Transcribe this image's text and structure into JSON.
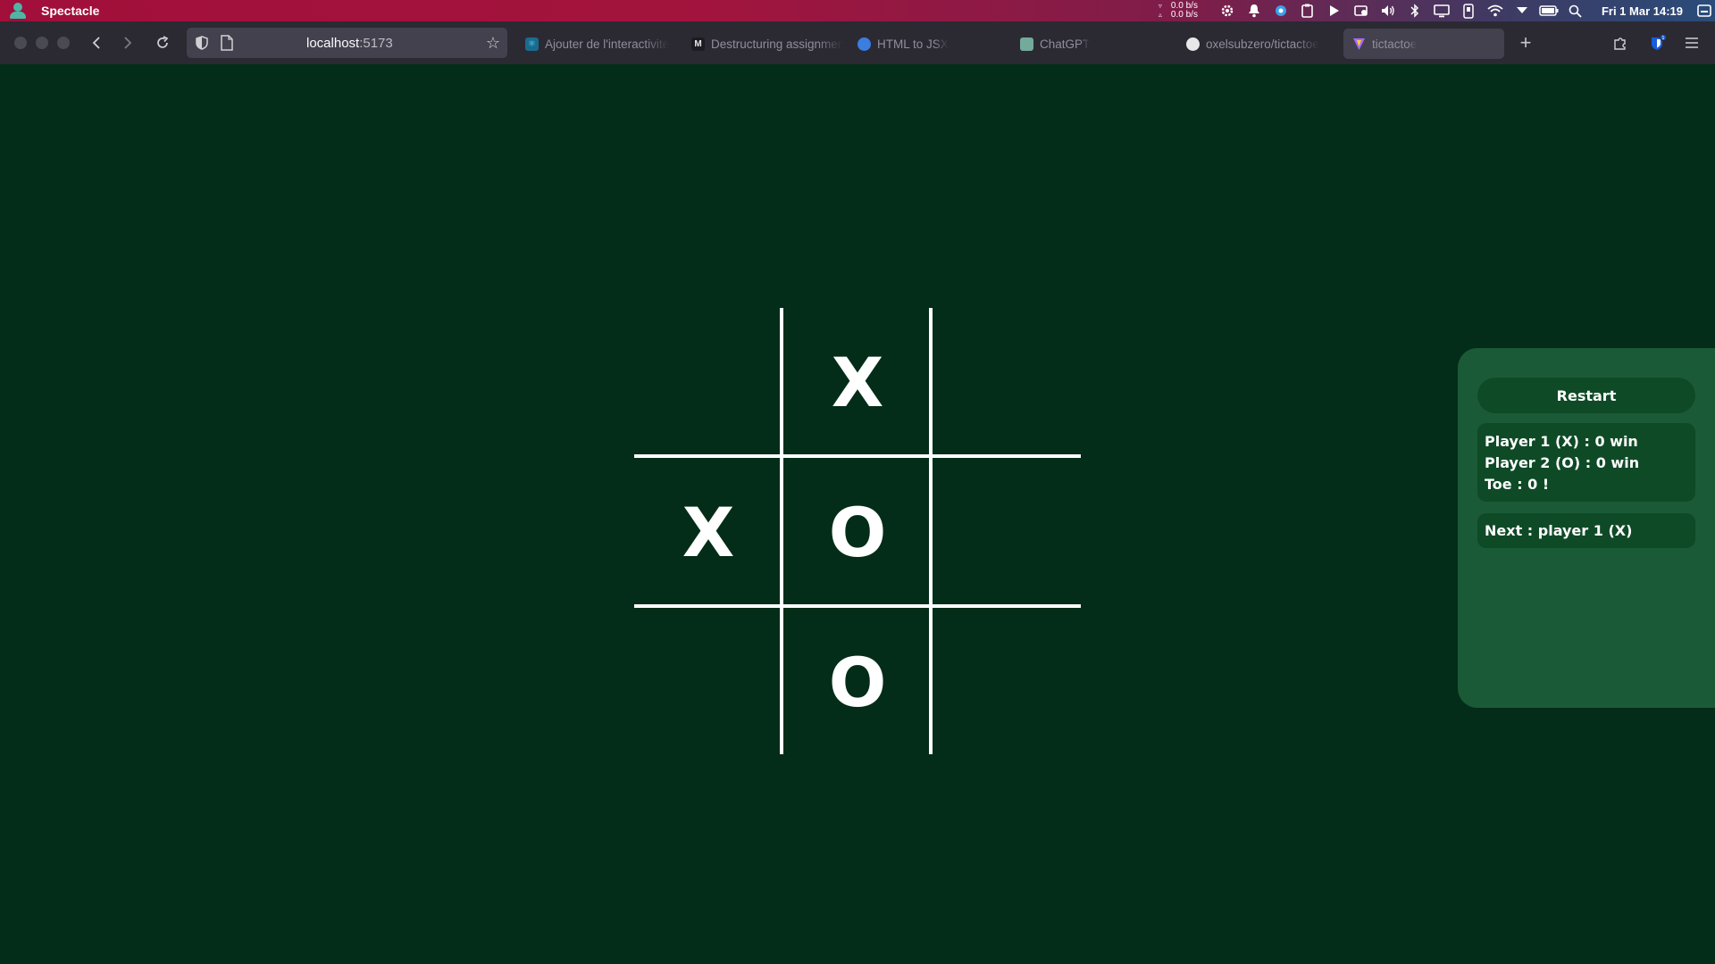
{
  "system_bar": {
    "app_name": "Spectacle",
    "net_up": "0.0 b/s",
    "net_down": "0.0 b/s",
    "clock": "Fri 1 Mar 14:19",
    "tray_icons": [
      "settings-gear-icon",
      "bell-icon",
      "gear-blue-icon",
      "clipboard-icon",
      "play-icon",
      "device-icon",
      "volume-icon",
      "bluetooth-icon",
      "display-icon",
      "usb-icon",
      "wifi-icon",
      "arrow-down-icon",
      "battery-icon",
      "search-icon",
      "window-icon"
    ]
  },
  "browser": {
    "url_host": "localhost",
    "url_port": ":5173",
    "tabs": [
      {
        "label": "Ajouter de l'interactivité",
        "icon": "react-icon",
        "color": "#1b6b8f"
      },
      {
        "label": "Destructuring assignment",
        "icon": "mdn-icon",
        "color": "#1c1b22"
      },
      {
        "label": "HTML to JSX",
        "icon": "globe-icon",
        "color": "#3c7de0"
      },
      {
        "label": "ChatGPT",
        "icon": "chatgpt-icon",
        "color": "#74aa9c"
      },
      {
        "label": "oxelsubzero/tictactoe",
        "icon": "github-icon",
        "color": "#2b2a33"
      },
      {
        "label": "tictactoe",
        "icon": "vite-icon",
        "color": "#a46bff"
      }
    ],
    "extension_badge": "1"
  },
  "game": {
    "cells": [
      "",
      "X",
      "",
      "X",
      "O",
      "",
      "",
      "O",
      ""
    ],
    "restart_label": "Restart",
    "score_lines": [
      "Player 1 (X) : 0 win",
      "Player 2 (O) : 0 win",
      "Toe : 0 !"
    ],
    "next_label": "Next : player 1 (X)"
  },
  "colors": {
    "background": "#032d18",
    "panel": "#1b5a37",
    "panel_box": "#0f4a27",
    "grid": "#ffffff"
  }
}
